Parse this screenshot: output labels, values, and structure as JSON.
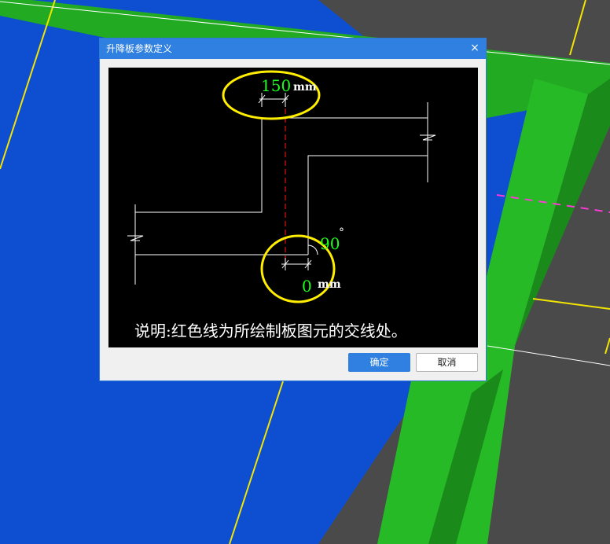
{
  "dialog": {
    "title": "升降板参数定义",
    "close_glyph": "×",
    "ok_label": "确定",
    "cancel_label": "取消"
  },
  "diagram": {
    "top_offset_value": "150",
    "top_offset_unit": "mm",
    "angle_value": "90",
    "angle_unit": "°",
    "bottom_offset_value": "0",
    "bottom_offset_unit": "mm",
    "note": "说明:红色线为所绘制板图元的交线处。"
  },
  "colors": {
    "highlight": "#ffee00",
    "value_text": "#19ff19",
    "intersection_line": "#e01010"
  }
}
